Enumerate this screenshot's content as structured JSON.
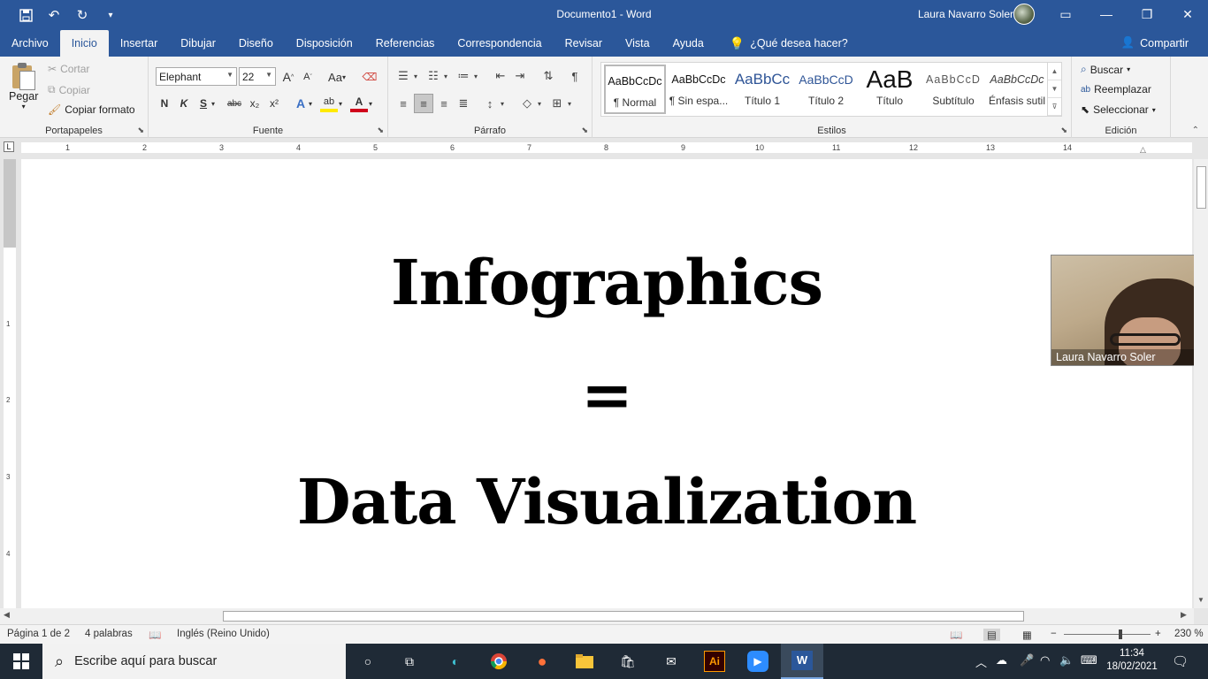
{
  "titlebar": {
    "doc_title": "Documento1  -  Word",
    "user_name": "Laura Navarro Soler"
  },
  "tabs": [
    "Archivo",
    "Inicio",
    "Insertar",
    "Dibujar",
    "Diseño",
    "Disposición",
    "Referencias",
    "Correspondencia",
    "Revisar",
    "Vista",
    "Ayuda"
  ],
  "tell_me": "¿Qué desea hacer?",
  "share": "Compartir",
  "clipboard": {
    "paste": "Pegar",
    "cut": "Cortar",
    "copy": "Copiar",
    "format_painter": "Copiar formato",
    "label": "Portapapeles"
  },
  "font": {
    "family": "Elephant",
    "size": "22",
    "grow": "A",
    "shrink": "A",
    "case": "Aa",
    "bold": "N",
    "italic": "K",
    "underline": "S",
    "strike": "abc",
    "subscript": "x₂",
    "superscript": "x²",
    "label": "Fuente"
  },
  "paragraph": {
    "label": "Párrafo"
  },
  "styles": {
    "label": "Estilos",
    "items": [
      {
        "preview": "AaBbCcDc",
        "name": "¶ Normal"
      },
      {
        "preview": "AaBbCcDc",
        "name": "¶ Sin espa..."
      },
      {
        "preview": "AaBbCc",
        "name": "Título 1"
      },
      {
        "preview": "AaBbCcD",
        "name": "Título 2"
      },
      {
        "preview": "AaB",
        "name": "Título"
      },
      {
        "preview": "AaBbCcD",
        "name": "Subtítulo"
      },
      {
        "preview": "AaBbCcDc",
        "name": "Énfasis sutil"
      }
    ]
  },
  "editing": {
    "find": "Buscar",
    "replace": "Reemplazar",
    "select": "Seleccionar",
    "label": "Edición"
  },
  "ruler": {
    "h_numbers": [
      "1",
      "2",
      "3",
      "4",
      "5",
      "6",
      "7",
      "8",
      "9",
      "10",
      "11",
      "12",
      "13",
      "14"
    ],
    "v_numbers": [
      "1",
      "2",
      "3",
      "4"
    ]
  },
  "document": {
    "line1": "Infographics",
    "line2": "=",
    "line3": "Data Visualization"
  },
  "webcam": {
    "name": "Laura Navarro Soler"
  },
  "status": {
    "page": "Página 1 de 2",
    "words": "4 palabras",
    "language": "Inglés (Reino Unido)",
    "zoom": "230 %",
    "zoom_minus": "−",
    "zoom_plus": "+"
  },
  "taskbar": {
    "search_placeholder": "Escribe aquí para buscar",
    "time": "11:34",
    "date": "18/02/2021",
    "ai_label": "Ai"
  },
  "colors": {
    "word_blue": "#2b579a",
    "ribbon_bg": "#f3f3f3",
    "taskbar_bg": "#1f2a36"
  }
}
